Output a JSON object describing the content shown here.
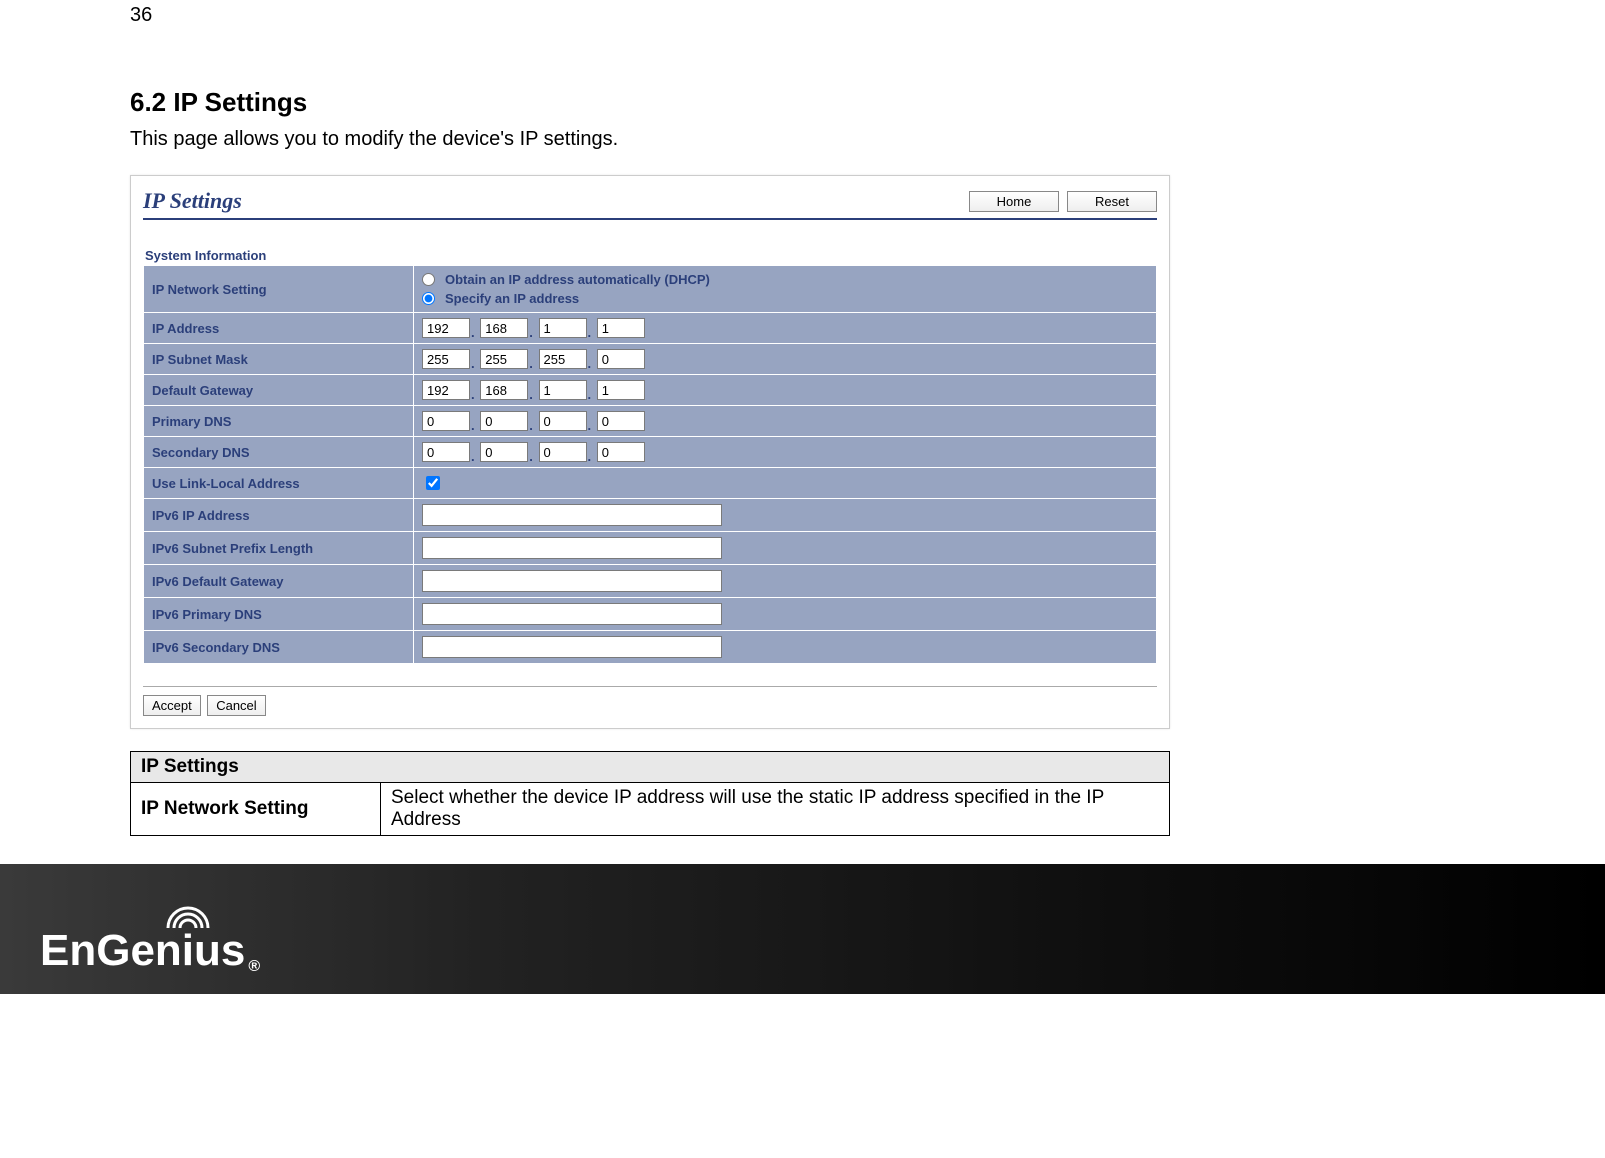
{
  "page_number": "36",
  "section": {
    "title": "6.2   IP Settings",
    "description": "This page allows you to modify the device's IP settings."
  },
  "screenshot": {
    "title": "IP Settings",
    "buttons": {
      "home": "Home",
      "reset": "Reset",
      "accept": "Accept",
      "cancel": "Cancel"
    },
    "system_info_heading": "System Information",
    "rows": {
      "ip_network_setting": "IP Network Setting",
      "dhcp_label": "Obtain an IP address automatically (DHCP)",
      "static_label": "Specify an IP address",
      "ip_address": "IP Address",
      "ip_subnet": "IP Subnet Mask",
      "default_gateway": "Default Gateway",
      "primary_dns": "Primary DNS",
      "secondary_dns": "Secondary DNS",
      "use_link_local": "Use Link-Local Address",
      "ipv6_ip": "IPv6 IP Address",
      "ipv6_prefix": "IPv6 Subnet Prefix Length",
      "ipv6_gateway": "IPv6 Default Gateway",
      "ipv6_primary_dns": "IPv6 Primary DNS",
      "ipv6_secondary_dns": "IPv6 Secondary DNS"
    },
    "values": {
      "ip_address": [
        "192",
        "168",
        "1",
        "1"
      ],
      "ip_subnet": [
        "255",
        "255",
        "255",
        "0"
      ],
      "default_gateway": [
        "192",
        "168",
        "1",
        "1"
      ],
      "primary_dns": [
        "0",
        "0",
        "0",
        "0"
      ],
      "secondary_dns": [
        "0",
        "0",
        "0",
        "0"
      ],
      "use_link_local_checked": true,
      "ipv6_ip": "",
      "ipv6_prefix": "",
      "ipv6_gateway": "",
      "ipv6_primary_dns": "",
      "ipv6_secondary_dns": ""
    }
  },
  "desc_table": {
    "header": "IP Settings",
    "row_label": "IP Network Setting",
    "row_text": "Select whether the device IP address will use the static IP address specified in the IP Address"
  },
  "brand": "EnGenius"
}
